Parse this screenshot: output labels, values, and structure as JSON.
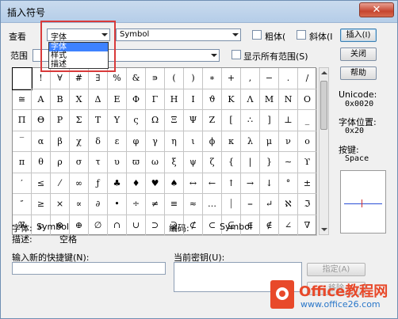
{
  "window": {
    "title": "插入符号",
    "close_glyph": "✕"
  },
  "view": {
    "label": "查看",
    "selected": "字体",
    "options": [
      "字体",
      "样式",
      "描述"
    ]
  },
  "font_combo": {
    "value": "Symbol"
  },
  "bold": {
    "label": "粗体("
  },
  "italic": {
    "label": "斜体(I"
  },
  "range": {
    "label": "范围",
    "value": ""
  },
  "show_all": {
    "label": "显示所有范围(S)"
  },
  "buttons": {
    "insert": "插入(I)",
    "close": "关闭",
    "help": "帮助",
    "assign": "指定(A)",
    "remove": "移除"
  },
  "symbols": [
    " ",
    "!",
    "∀",
    "#",
    "∃",
    "%",
    "&",
    "∍",
    "(",
    ")",
    "∗",
    "+",
    ",",
    "−",
    ".",
    "/",
    "≅",
    "Α",
    "Β",
    "Χ",
    "Δ",
    "Ε",
    "Φ",
    "Γ",
    "Η",
    "Ι",
    "ϑ",
    "Κ",
    "Λ",
    "Μ",
    "Ν",
    "Ο",
    "Π",
    "Θ",
    "Ρ",
    "Σ",
    "Τ",
    "Υ",
    "ς",
    "Ω",
    "Ξ",
    "Ψ",
    "Ζ",
    "[",
    "∴",
    "]",
    "⊥",
    "_",
    "‾",
    "α",
    "β",
    "χ",
    "δ",
    "ε",
    "φ",
    "γ",
    "η",
    "ι",
    "ϕ",
    "κ",
    "λ",
    "μ",
    "ν",
    "ο",
    "π",
    "θ",
    "ρ",
    "σ",
    "τ",
    "υ",
    "ϖ",
    "ω",
    "ξ",
    "ψ",
    "ζ",
    "{",
    "|",
    "}",
    "∼",
    "ϒ",
    "′",
    "≤",
    "⁄",
    "∞",
    "ƒ",
    "♣",
    "♦",
    "♥",
    "♠",
    "↔",
    "←",
    "↑",
    "→",
    "↓",
    "°",
    "±",
    "″",
    "≥",
    "×",
    "∝",
    "∂",
    "•",
    "÷",
    "≠",
    "≡",
    "≈",
    "…",
    "⏐",
    "⎯",
    "↵",
    "ℵ",
    "ℑ",
    "ℜ",
    "℘",
    "⊗",
    "⊕",
    "∅",
    "∩",
    "∪",
    "⊃",
    "⊇",
    "⊄",
    "⊂",
    "⊆",
    "∈",
    "∉",
    "∠",
    "∇"
  ],
  "unicode_info": {
    "label": "Unicode:",
    "value": "0x0020",
    "pos_label": "字体位置:",
    "pos_value": "0x20",
    "key_label": "按键:",
    "key_value": "Space"
  },
  "info": {
    "font_label": "字体:",
    "font_value": "Symbol",
    "code_label": "编码:",
    "code_value": "Symbol",
    "desc_label": "描述:",
    "desc_value": "空格"
  },
  "shortcut": {
    "new_label": "输入新的快捷键(N):",
    "new_value": "",
    "current_label": "当前密钥(U):"
  },
  "watermark": {
    "line1": "Office教程网",
    "line2": "www.office26.com"
  }
}
